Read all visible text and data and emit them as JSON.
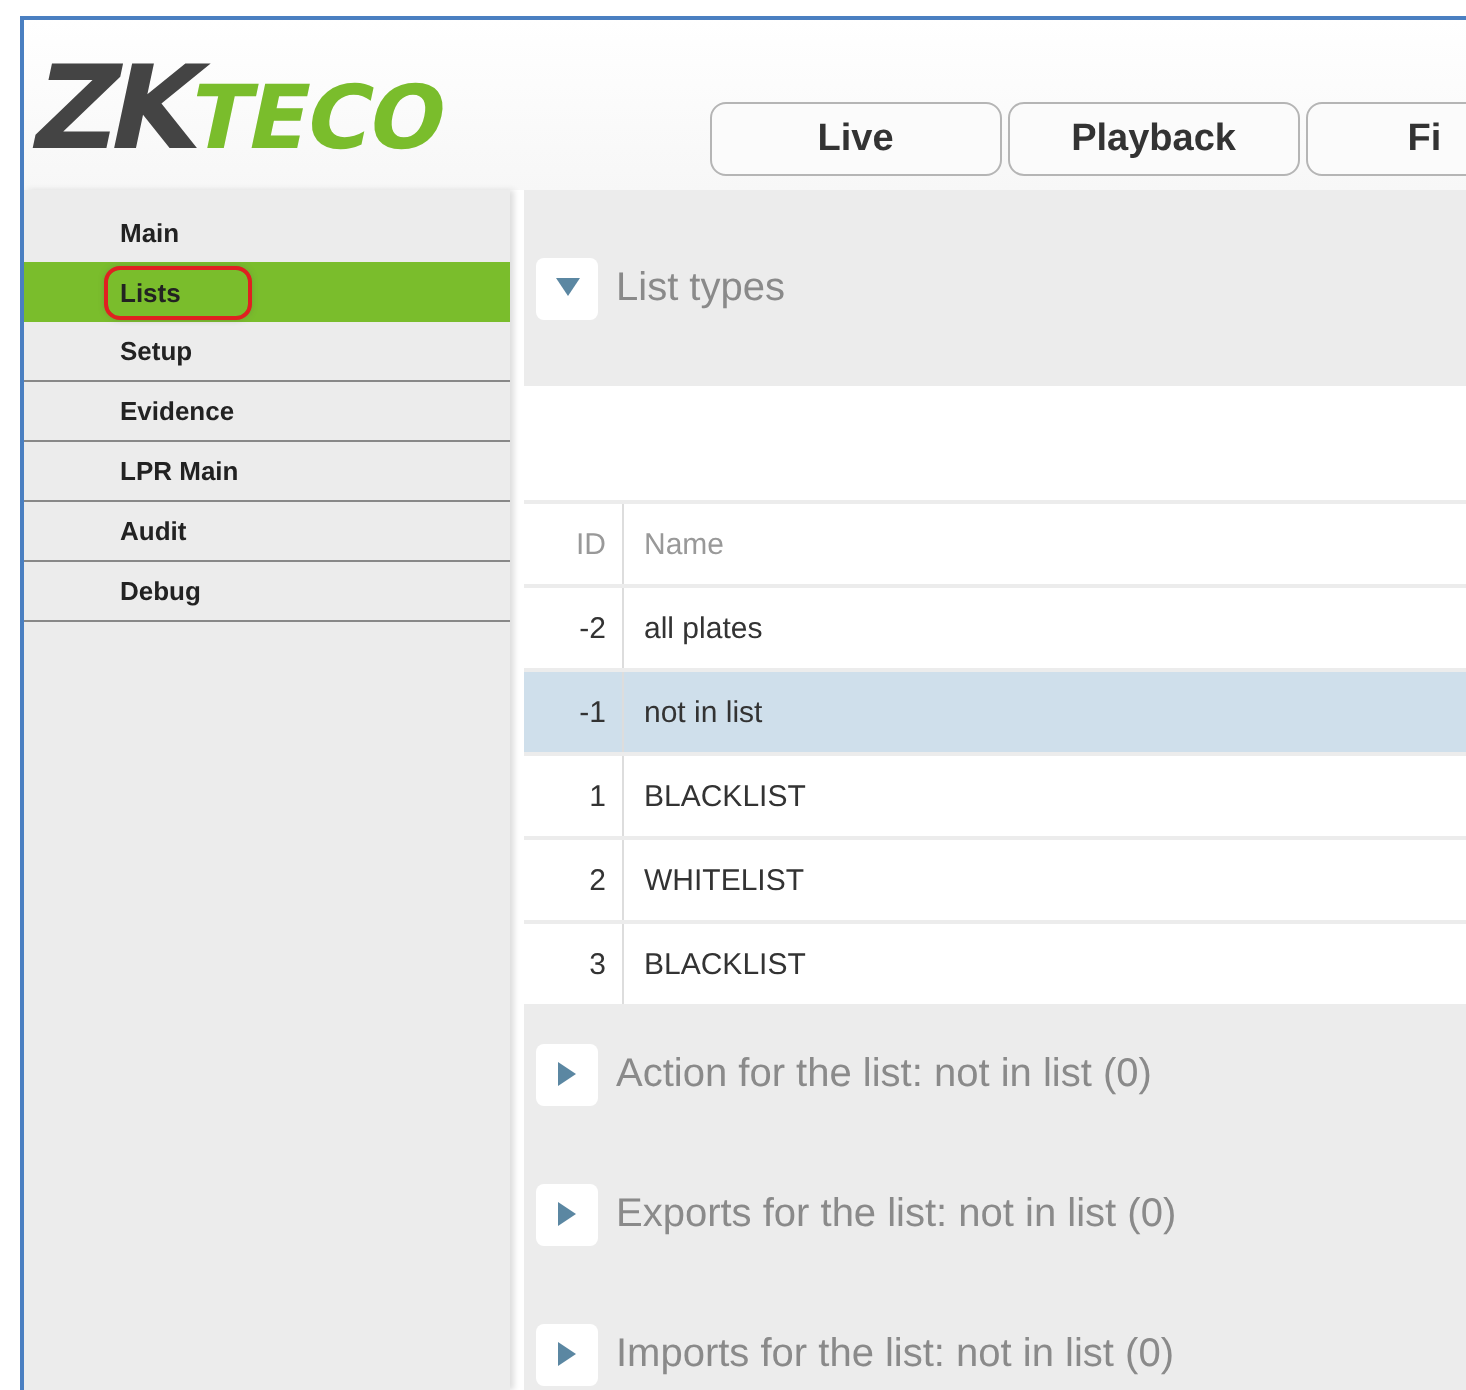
{
  "logo": {
    "mark": "ZK",
    "accent": "TECO"
  },
  "tabs": [
    {
      "label": "Live",
      "selected": false
    },
    {
      "label": "Playback",
      "selected": false
    },
    {
      "label": "Fi",
      "selected": false
    }
  ],
  "sidebar": {
    "items": [
      {
        "label": "Main",
        "selected": false,
        "callout": false
      },
      {
        "label": "Lists",
        "selected": true,
        "callout": true
      },
      {
        "label": "Setup",
        "selected": false,
        "callout": false
      },
      {
        "label": "Evidence",
        "selected": false,
        "callout": false
      },
      {
        "label": "LPR Main",
        "selected": false,
        "callout": false
      },
      {
        "label": "Audit",
        "selected": false,
        "callout": false
      },
      {
        "label": "Debug",
        "selected": false,
        "callout": false
      }
    ]
  },
  "list_types": {
    "title": "List types",
    "expanded": true,
    "table": {
      "columns": [
        "ID",
        "Name"
      ],
      "rows": [
        {
          "id": "-2",
          "name": "all plates",
          "selected": false
        },
        {
          "id": "-1",
          "name": "not in list",
          "selected": true
        },
        {
          "id": "1",
          "name": "BLACKLIST",
          "selected": false
        },
        {
          "id": "2",
          "name": "WHITELIST",
          "selected": false
        },
        {
          "id": "3",
          "name": "BLACKLIST",
          "selected": false
        }
      ]
    }
  },
  "sections": [
    {
      "title": "Action for the list: not in list (0)",
      "expanded": false
    },
    {
      "title": "Exports for the list: not in list (0)",
      "expanded": false
    },
    {
      "title": "Imports for the list: not in list (0)",
      "expanded": false
    }
  ]
}
